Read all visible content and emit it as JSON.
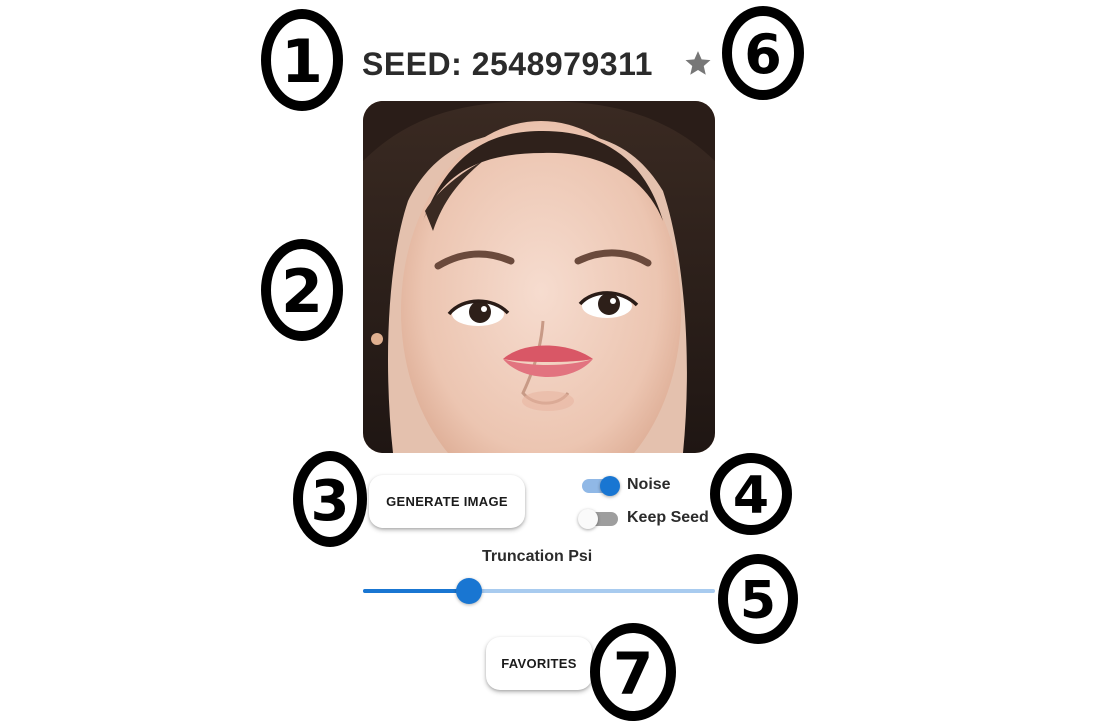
{
  "header": {
    "seed_label": "SEED: 2548979311",
    "favorite_icon": "star-icon",
    "favorite_color": "#777777"
  },
  "image": {
    "content": "generated face portrait"
  },
  "controls": {
    "generate_label": "GENERATE IMAGE",
    "noise_label": "Noise",
    "noise_on": true,
    "keep_seed_label": "Keep Seed",
    "keep_seed_on": false,
    "truncation_label": "Truncation Psi",
    "truncation_value": 0.3,
    "favorites_label": "FAVORITES",
    "accent_color": "#1976d2"
  },
  "annotations": [
    "1",
    "2",
    "3",
    "4",
    "5",
    "6",
    "7"
  ]
}
